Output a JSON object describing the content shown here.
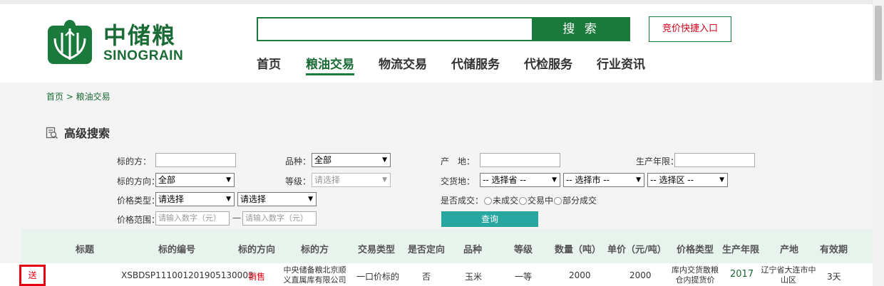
{
  "header": {
    "logo_cn": "中储粮",
    "logo_en": "SINOGRAIN",
    "search_value": "",
    "search_button": "搜 索",
    "quick_entry": "竞价快捷入口",
    "nav": [
      "首页",
      "粮油交易",
      "物流交易",
      "代储服务",
      "代检服务",
      "行业资讯"
    ],
    "active_nav_index": 1
  },
  "breadcrumb": "首页 > 粮油交易",
  "advanced_search": {
    "title": "高级搜索",
    "labels": {
      "subject": "标的方：",
      "variety": "品种：",
      "origin": "产　地：",
      "production_year": "生产年限：",
      "direction": "标的方向：",
      "grade": "等级：",
      "delivery": "交货地：",
      "price_type": "价格类型：",
      "deal_status": "是否成交：",
      "price_range": "价格范围："
    },
    "values": {
      "variety": "全部",
      "direction": "全部",
      "grade_placeholder": "请选择",
      "province": "-- 选择省 --",
      "city": "-- 选择市 --",
      "district": "-- 选择区 --",
      "price_type_1": "请选择",
      "price_type_2": "请选择",
      "price_min_placeholder": "请输入数字（元）",
      "price_max_placeholder": "请输入数字（元）",
      "dash": "一"
    },
    "deal_options": [
      "未成交",
      "交易中",
      "部分成交"
    ],
    "query_button": "查询"
  },
  "table": {
    "headers": [
      "标题",
      "标的编号",
      "标的方向",
      "标的方",
      "交易类型",
      "是否定向",
      "品种",
      "等级",
      "数量（吨）",
      "单价（元/吨）",
      "价格类型",
      "生产年限",
      "产地",
      "有效期"
    ],
    "row": {
      "tag": "送",
      "id": "XSBDSP111001201905130003",
      "direction": "销售",
      "party": "中央储备粮北京顺义直属库有限公司",
      "trade_type": "一口价标的",
      "directed": "否",
      "variety": "玉米",
      "grade": "一等",
      "quantity": "2000",
      "unit_price": "2000",
      "price_type": "库内交货散粮仓内提货价",
      "year": "2017",
      "origin": "辽宁省大连市中山区",
      "validity": "3天"
    }
  },
  "colors": {
    "brand_green": "#1a7a3c",
    "teal_button": "#28a7a0",
    "alert_red": "#e60012"
  }
}
